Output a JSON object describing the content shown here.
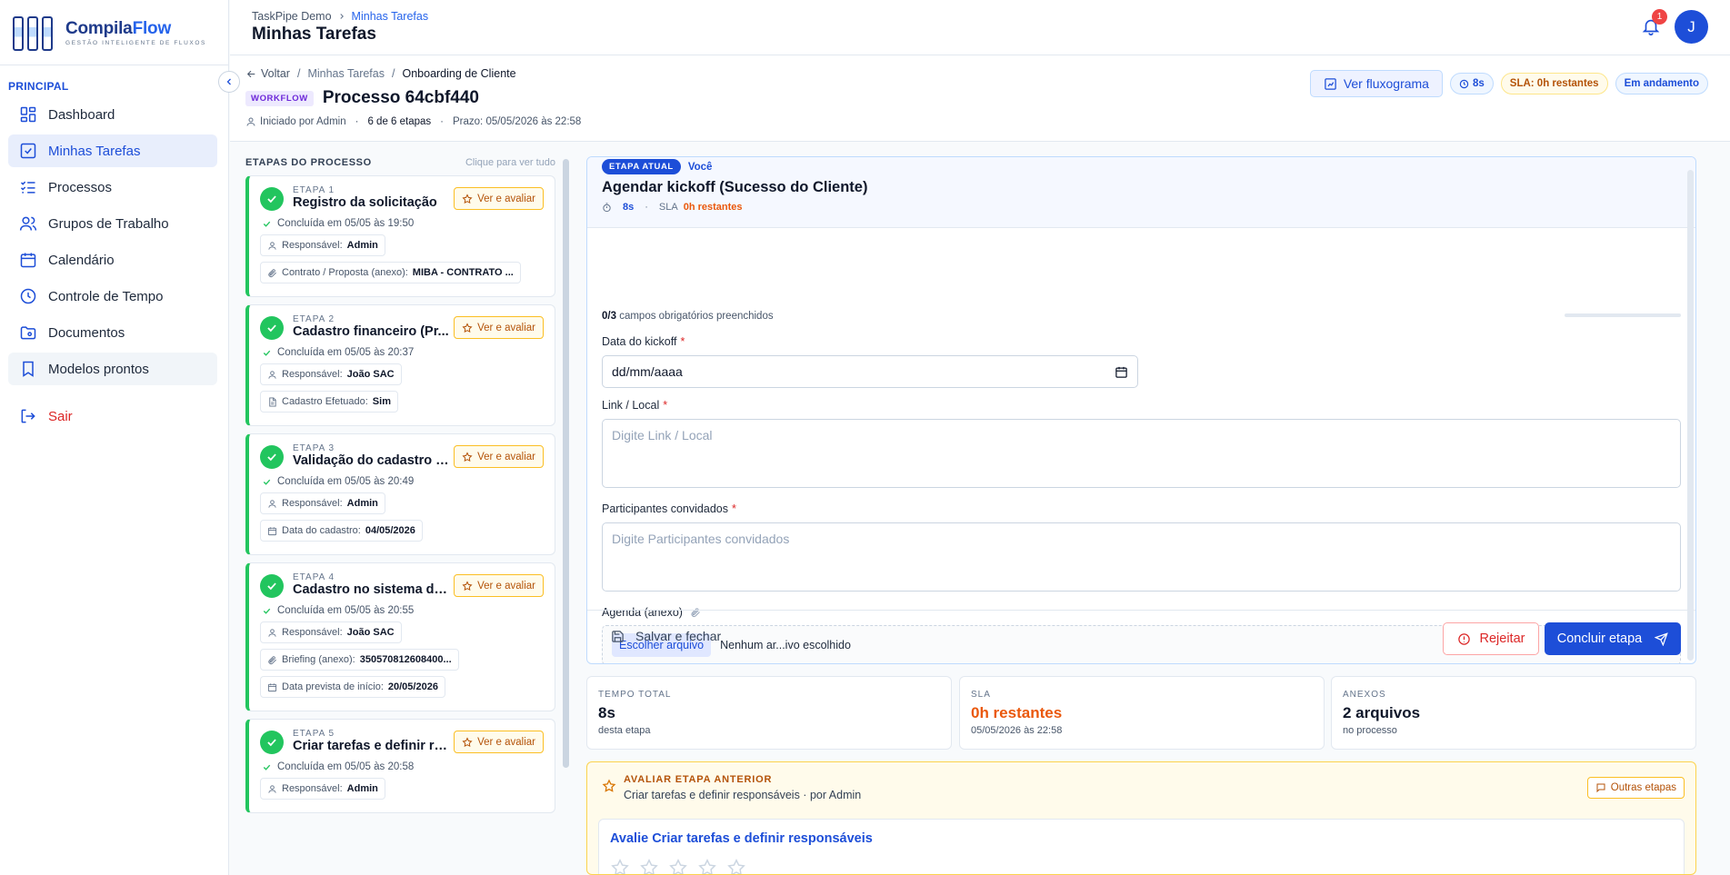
{
  "brand": {
    "name_a": "Compila",
    "name_b": "Flow",
    "tagline": "GESTÃO INTELIGENTE DE FLUXOS"
  },
  "sidebar": {
    "section": "PRINCIPAL",
    "items": [
      {
        "label": "Dashboard",
        "icon": "dashboard-icon"
      },
      {
        "label": "Minhas Tarefas",
        "icon": "checkbox-icon",
        "active": true
      },
      {
        "label": "Processos",
        "icon": "list-icon"
      },
      {
        "label": "Grupos de Trabalho",
        "icon": "users-icon"
      },
      {
        "label": "Calendário",
        "icon": "calendar-icon"
      },
      {
        "label": "Controle de Tempo",
        "icon": "clock-icon"
      },
      {
        "label": "Documentos",
        "icon": "folder-icon"
      },
      {
        "label": "Modelos prontos",
        "icon": "bookmark-icon"
      }
    ],
    "logout": "Sair"
  },
  "header": {
    "crumb_root": "TaskPipe Demo",
    "crumb_current": "Minhas Tarefas",
    "title": "Minhas Tarefas",
    "notif_count": "1",
    "avatar_initial": "J"
  },
  "process": {
    "back": "Voltar",
    "crumb_1": "Minhas Tarefas",
    "crumb_2": "Onboarding de Cliente",
    "tag": "WORKFLOW",
    "title": "Processo 64cbf440",
    "started_by": "Iniciado por Admin",
    "steps_count": "6 de 6 etapas",
    "deadline": "Prazo: 05/05/2026 às 22:58",
    "btn_flow": "Ver fluxograma",
    "time_pill": "8s",
    "sla_pill": "SLA: 0h restantes",
    "state_pill": "Em andamento"
  },
  "steps_panel": {
    "title": "ETAPAS DO PROCESSO",
    "hint": "Clique para ver tudo",
    "eval_label": "Ver e avaliar",
    "steps": [
      {
        "num": "ETAPA 1",
        "name": "Registro da solicitação",
        "done": "Concluída em 05/05 às 19:50",
        "chips": [
          {
            "k": "Responsável:",
            "v": "Admin",
            "icon": "user"
          },
          {
            "k": "Contrato / Proposta (anexo):",
            "v": "MIBA - CONTRATO ...",
            "icon": "clip"
          }
        ]
      },
      {
        "num": "ETAPA 2",
        "name": "Cadastro financeiro (Pr...",
        "done": "Concluída em 05/05 às 20:37",
        "chips": [
          {
            "k": "Responsável:",
            "v": "João SAC",
            "icon": "user"
          },
          {
            "k": "Cadastro Efetuado:",
            "v": "Sim",
            "icon": "doc"
          }
        ]
      },
      {
        "num": "ETAPA 3",
        "name": "Validação do cadastro fi...",
        "done": "Concluída em 05/05 às 20:49",
        "chips": [
          {
            "k": "Responsável:",
            "v": "Admin",
            "icon": "user"
          },
          {
            "k": "Data do cadastro:",
            "v": "04/05/2026",
            "icon": "cal"
          }
        ]
      },
      {
        "num": "ETAPA 4",
        "name": "Cadastro no sistema de...",
        "done": "Concluída em 05/05 às 20:55",
        "chips": [
          {
            "k": "Responsável:",
            "v": "João SAC",
            "icon": "user"
          },
          {
            "k": "Briefing (anexo):",
            "v": "350570812608400...",
            "icon": "clip"
          },
          {
            "k": "Data prevista de início:",
            "v": "20/05/2026",
            "icon": "cal"
          }
        ]
      },
      {
        "num": "ETAPA 5",
        "name": "Criar tarefas e definir re...",
        "done": "Concluída em 05/05 às 20:58",
        "chips": [
          {
            "k": "Responsável:",
            "v": "Admin",
            "icon": "user"
          }
        ]
      }
    ]
  },
  "current": {
    "tag": "ETAPA ATUAL",
    "you": "Você",
    "title": "Agendar kickoff (Sucesso do Cliente)",
    "time": "8s",
    "sla_label": "SLA",
    "sla_value": "0h restantes",
    "progress_count": "0/3",
    "progress_text": "campos obrigatórios preenchidos",
    "progress_fraction": 0,
    "fields": {
      "date_label": "Data do kickoff",
      "date_value": "dd/mm/aaaa",
      "link_label": "Link / Local",
      "link_placeholder": "Digite Link / Local",
      "participants_label": "Participantes convidados",
      "participants_placeholder": "Digite Participantes convidados",
      "agenda_label": "Agenda (anexo)",
      "file_button": "Escolher arquivo",
      "file_status": "Nenhum ar...ivo escolhido"
    },
    "save": "Salvar e fechar",
    "reject": "Rejeitar",
    "conclude": "Concluir etapa"
  },
  "stats": [
    {
      "label": "TEMPO TOTAL",
      "value": "8s",
      "sub": "desta etapa"
    },
    {
      "label": "SLA",
      "value": "0h restantes",
      "sub": "05/05/2026 às 22:58"
    },
    {
      "label": "ANEXOS",
      "value": "2 arquivos",
      "sub": "no processo"
    }
  ],
  "evaluate": {
    "title": "AVALIAR ETAPA ANTERIOR",
    "sub": "Criar tarefas e definir responsáveis · por Admin",
    "others": "Outras etapas",
    "card_title": "Avalie Criar tarefas e definir responsáveis",
    "stars_total": 5
  },
  "colors": {
    "primary": "#1d4ed8",
    "success": "#22c55e",
    "warning": "#b45309",
    "danger": "#dc2626"
  }
}
